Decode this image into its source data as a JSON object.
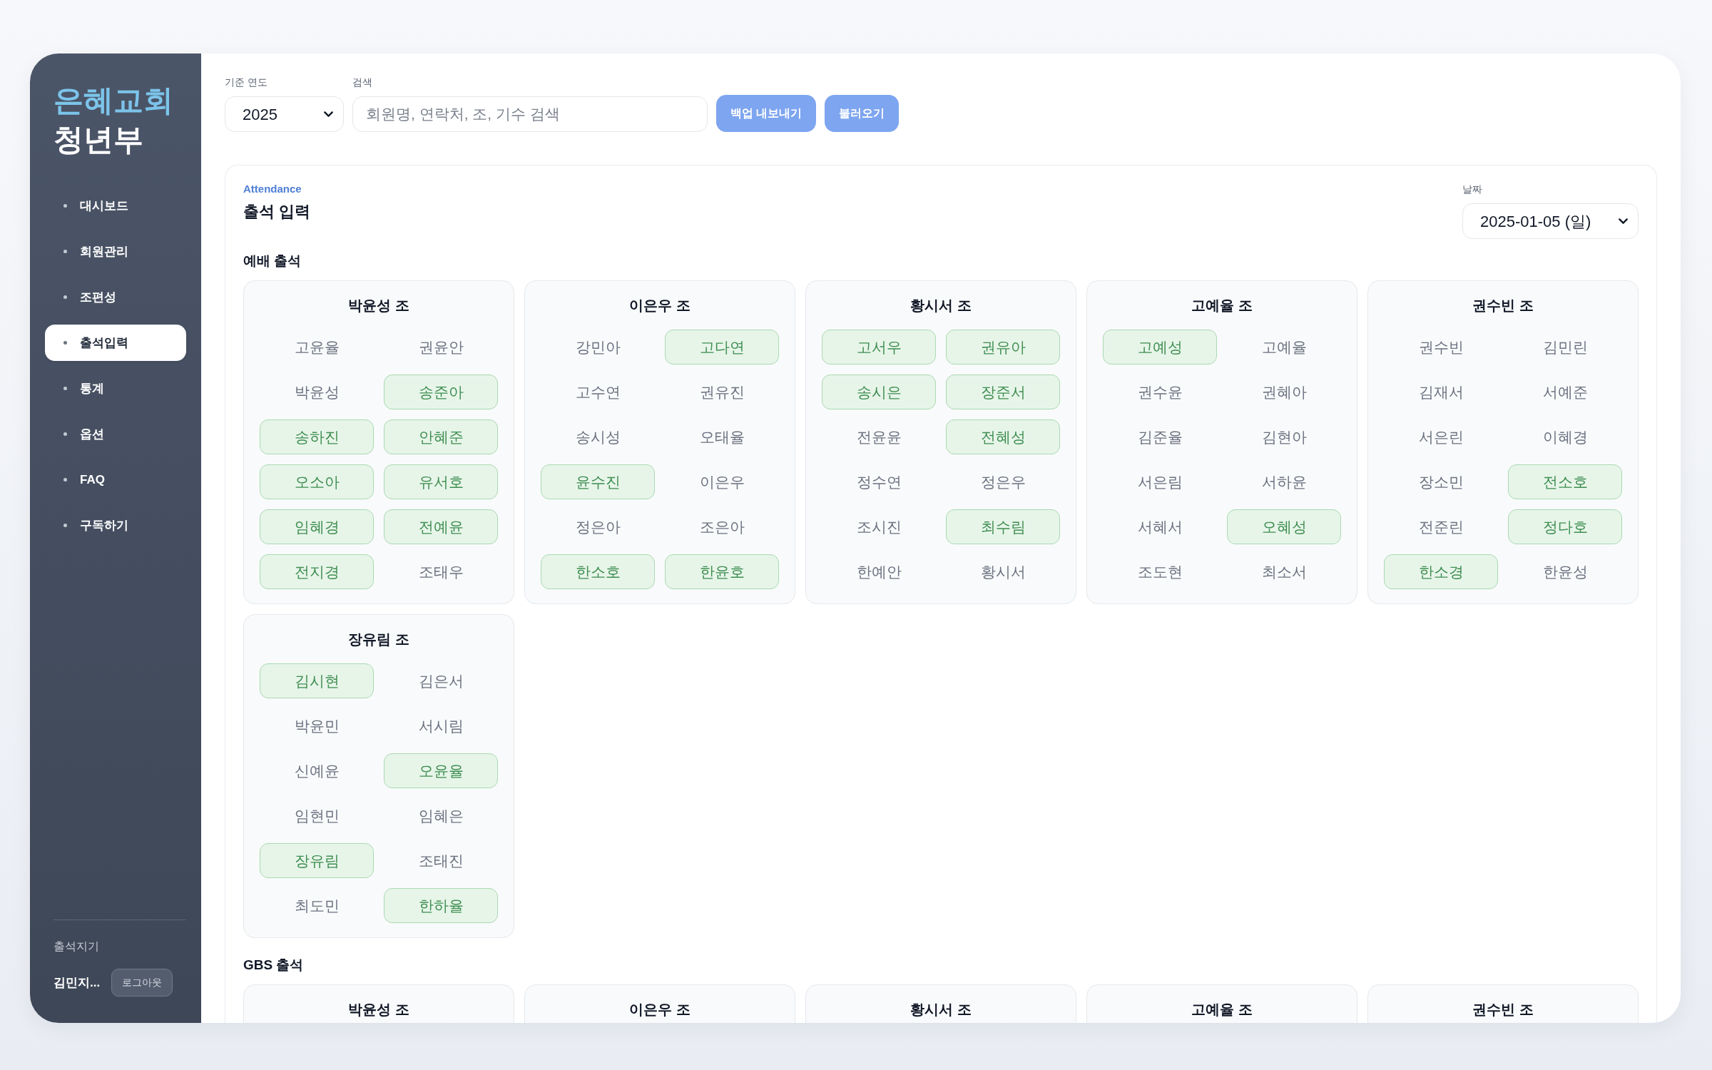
{
  "sidebar": {
    "brand": {
      "line_1": "은혜교회",
      "line_2": "청년부"
    },
    "items": [
      {
        "label": "대시보드",
        "selected": false
      },
      {
        "label": "회원관리",
        "selected": false
      },
      {
        "label": "조편성",
        "selected": false
      },
      {
        "label": "출석입력",
        "selected": true
      },
      {
        "label": "통계",
        "selected": false
      },
      {
        "label": "옵션",
        "selected": false
      },
      {
        "label": "FAQ",
        "selected": false
      },
      {
        "label": "구독하기",
        "selected": false
      }
    ],
    "footer": {
      "role": "출석지기",
      "user": "김민지...",
      "logout": "로그아웃"
    }
  },
  "toolbar": {
    "year": {
      "label": "기준 연도",
      "value": "2025"
    },
    "search": {
      "label": "검색",
      "placeholder": "회원명, 연락처, 조, 기수 검색"
    },
    "buttons": [
      "백업 내보내기",
      "불러오기"
    ]
  },
  "panel": {
    "eyebrow": "Attendance",
    "title": "출석 입력",
    "date": {
      "label": "날짜",
      "value": "2025-01-05 (일)"
    },
    "sections": [
      {
        "title": "예배 출석",
        "groups": [
          {
            "title": "박윤성 조",
            "members": [
              {
                "name": "고윤율",
                "present": false
              },
              {
                "name": "권윤안",
                "present": false
              },
              {
                "name": "박윤성",
                "present": false
              },
              {
                "name": "송준아",
                "present": true
              },
              {
                "name": "송하진",
                "present": true
              },
              {
                "name": "안혜준",
                "present": true
              },
              {
                "name": "오소아",
                "present": true
              },
              {
                "name": "유서호",
                "present": true
              },
              {
                "name": "임혜경",
                "present": true
              },
              {
                "name": "전예윤",
                "present": true
              },
              {
                "name": "전지경",
                "present": true
              },
              {
                "name": "조태우",
                "present": false
              }
            ]
          },
          {
            "title": "이은우 조",
            "members": [
              {
                "name": "강민아",
                "present": false
              },
              {
                "name": "고다연",
                "present": true
              },
              {
                "name": "고수연",
                "present": false
              },
              {
                "name": "권유진",
                "present": false
              },
              {
                "name": "송시성",
                "present": false
              },
              {
                "name": "오태율",
                "present": false
              },
              {
                "name": "윤수진",
                "present": true
              },
              {
                "name": "이은우",
                "present": false
              },
              {
                "name": "정은아",
                "present": false
              },
              {
                "name": "조은아",
                "present": false
              },
              {
                "name": "한소호",
                "present": true
              },
              {
                "name": "한윤호",
                "present": true
              }
            ]
          },
          {
            "title": "황시서 조",
            "members": [
              {
                "name": "고서우",
                "present": true
              },
              {
                "name": "권유아",
                "present": true
              },
              {
                "name": "송시은",
                "present": true
              },
              {
                "name": "장준서",
                "present": true
              },
              {
                "name": "전윤윤",
                "present": false
              },
              {
                "name": "전혜성",
                "present": true
              },
              {
                "name": "정수연",
                "present": false
              },
              {
                "name": "정은우",
                "present": false
              },
              {
                "name": "조시진",
                "present": false
              },
              {
                "name": "최수림",
                "present": true
              },
              {
                "name": "한예안",
                "present": false
              },
              {
                "name": "황시서",
                "present": false
              }
            ]
          },
          {
            "title": "고예율 조",
            "members": [
              {
                "name": "고예성",
                "present": true
              },
              {
                "name": "고예율",
                "present": false
              },
              {
                "name": "권수윤",
                "present": false
              },
              {
                "name": "권혜아",
                "present": false
              },
              {
                "name": "김준율",
                "present": false
              },
              {
                "name": "김현아",
                "present": false
              },
              {
                "name": "서은림",
                "present": false
              },
              {
                "name": "서하윤",
                "present": false
              },
              {
                "name": "서혜서",
                "present": false
              },
              {
                "name": "오혜성",
                "present": true
              },
              {
                "name": "조도현",
                "present": false
              },
              {
                "name": "최소서",
                "present": false
              }
            ]
          },
          {
            "title": "권수빈 조",
            "members": [
              {
                "name": "권수빈",
                "present": false
              },
              {
                "name": "김민린",
                "present": false
              },
              {
                "name": "김재서",
                "present": false
              },
              {
                "name": "서예준",
                "present": false
              },
              {
                "name": "서은린",
                "present": false
              },
              {
                "name": "이혜경",
                "present": false
              },
              {
                "name": "장소민",
                "present": false
              },
              {
                "name": "전소호",
                "present": true
              },
              {
                "name": "전준린",
                "present": false
              },
              {
                "name": "정다호",
                "present": true
              },
              {
                "name": "한소경",
                "present": true
              },
              {
                "name": "한윤성",
                "present": false
              }
            ]
          },
          {
            "title": "장유림 조",
            "members": [
              {
                "name": "김시현",
                "present": true
              },
              {
                "name": "김은서",
                "present": false
              },
              {
                "name": "박윤민",
                "present": false
              },
              {
                "name": "서시림",
                "present": false
              },
              {
                "name": "신예윤",
                "present": false
              },
              {
                "name": "오윤율",
                "present": true
              },
              {
                "name": "임현민",
                "present": false
              },
              {
                "name": "임혜은",
                "present": false
              },
              {
                "name": "장유림",
                "present": true
              },
              {
                "name": "조태진",
                "present": false
              },
              {
                "name": "최도민",
                "present": false
              },
              {
                "name": "한하율",
                "present": true
              }
            ]
          }
        ]
      },
      {
        "title": "GBS 출석",
        "groups": [
          {
            "title": "박윤성 조"
          },
          {
            "title": "이은우 조"
          },
          {
            "title": "황시서 조"
          },
          {
            "title": "고예율 조"
          },
          {
            "title": "권수빈 조"
          }
        ]
      }
    ]
  }
}
